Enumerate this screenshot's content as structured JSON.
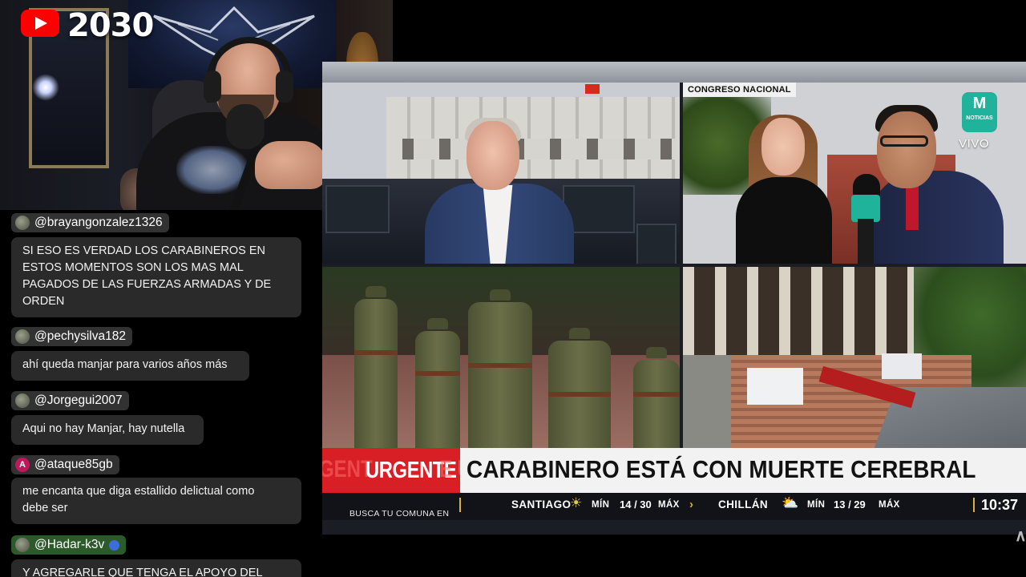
{
  "overlay": {
    "channel_number": "2030",
    "youtube_icon": "youtube-play-icon"
  },
  "chat": {
    "messages": [
      {
        "user": "@brayangonzalez1326",
        "text": "SI ESO ES VERDAD LOS CARABINEROS EN\nESTOS MOMENTOS SON LOS MAS MAL\nPAGADOS DE LAS FUERZAS ARMADAS Y DE\nORDEN"
      },
      {
        "user": "@pechysilva182",
        "text": "ahí queda manjar para varios años más"
      },
      {
        "user": "@Jorgegui2007",
        "text": "Aqui no hay Manjar, hay nutella"
      },
      {
        "user": "@ataque85gb",
        "avatar_letter": "A",
        "text": "me encanta que diga estallido delictual como\ndebe ser"
      },
      {
        "user": "@Hadar-k3v",
        "text": "Y AGREGARLE QUE TENGA EL APOYO DEL"
      }
    ]
  },
  "broadcast": {
    "location_tag": "CONGRESO NACIONAL",
    "network_logo_word": "NOTICIAS",
    "network_logo_mark": "M",
    "live_label": "VIVO",
    "urgent_label": "URGENTE",
    "urgent_ghost_left": "GENT",
    "urgent_ghost_right": "E U",
    "headline": "CARABINERO ESTÁ CON MUERTE CEREBRAL",
    "ticker": {
      "promo": "BUSCA TU COMUNA EN",
      "cities": [
        {
          "name": "SANTIAGO",
          "min_label": "MÍN",
          "temps": "14 / 30",
          "max_label": "MÁX",
          "icon": "sun-icon"
        },
        {
          "name": "CHILLÁN",
          "min_label": "MÍN",
          "temps": "13 / 29",
          "max_label": "MÁX",
          "icon": "partly-cloudy-icon"
        }
      ],
      "clock": "10:37"
    }
  },
  "colors": {
    "urgent_red": "#d91f26",
    "network_teal": "#1fb39b",
    "ticker_accent": "#d8b23a"
  }
}
